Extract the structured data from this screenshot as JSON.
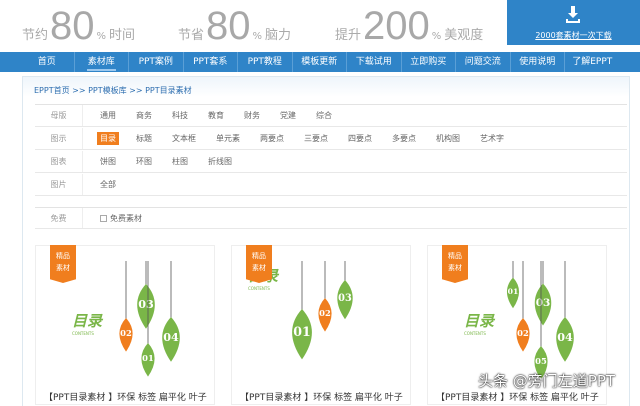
{
  "banner": {
    "slogans": [
      {
        "pre": "节约",
        "num": "80",
        "pct": "%",
        "post": "时间"
      },
      {
        "pre": "节省",
        "num": "80",
        "pct": "%",
        "post": "脑力"
      },
      {
        "pre": "提升",
        "num": "200",
        "pct": "%",
        "post": "美观度"
      }
    ],
    "download_label": "2000套素材一次下载"
  },
  "nav": [
    "首页",
    "素材库",
    "PPT案例",
    "PPT套系",
    "PPT教程",
    "模板更新",
    "下载试用",
    "立即购买",
    "问题交流",
    "使用说明",
    "了解EPPT"
  ],
  "breadcrumb": "EPPT首页 >> PPT模板库 >> PPT目录素材",
  "filters": [
    {
      "label": "母版",
      "options": [
        "通用",
        "商务",
        "科技",
        "教育",
        "财务",
        "党建",
        "综合"
      ]
    },
    {
      "label": "图示",
      "options": [
        "目录",
        "标题",
        "文本框",
        "单元素",
        "两要点",
        "三要点",
        "四要点",
        "多要点",
        "机构图",
        "艺术字"
      ],
      "selected": "目录"
    },
    {
      "label": "图表",
      "options": [
        "饼图",
        "环图",
        "柱图",
        "折线图"
      ]
    },
    {
      "label": "图片",
      "options": [
        "全部"
      ]
    }
  ],
  "free": {
    "label": "免费",
    "checkbox": "免费素材"
  },
  "cards": [
    {
      "tag1": "精品",
      "tag2": "素材",
      "title": "【PPT目录素材 】环保 标签 扁平化 叶子",
      "leaves": [
        "03",
        "02",
        "04",
        "01"
      ],
      "logo": "目录",
      "logo_sub": "CONTENTS"
    },
    {
      "tag1": "精品",
      "tag2": "素材",
      "title": "【PPT目录素材 】环保 标签 扁平化 叶子",
      "leaves": [
        "01",
        "02",
        "03"
      ],
      "logo": "目录",
      "logo_sub": "CONTENTS"
    },
    {
      "tag1": "精品",
      "tag2": "素材",
      "title": "【PPT目录素材 】环保 标签 扁平化 叶子",
      "leaves": [
        "01",
        "03",
        "02",
        "04",
        "05"
      ],
      "logo": "目录",
      "logo_sub": "CONTENTS"
    }
  ],
  "watermark": "头条 @旁门左道PPT",
  "colors": {
    "blue": "#2f84c8",
    "orange": "#f07e1e",
    "green": "#7ab648"
  }
}
